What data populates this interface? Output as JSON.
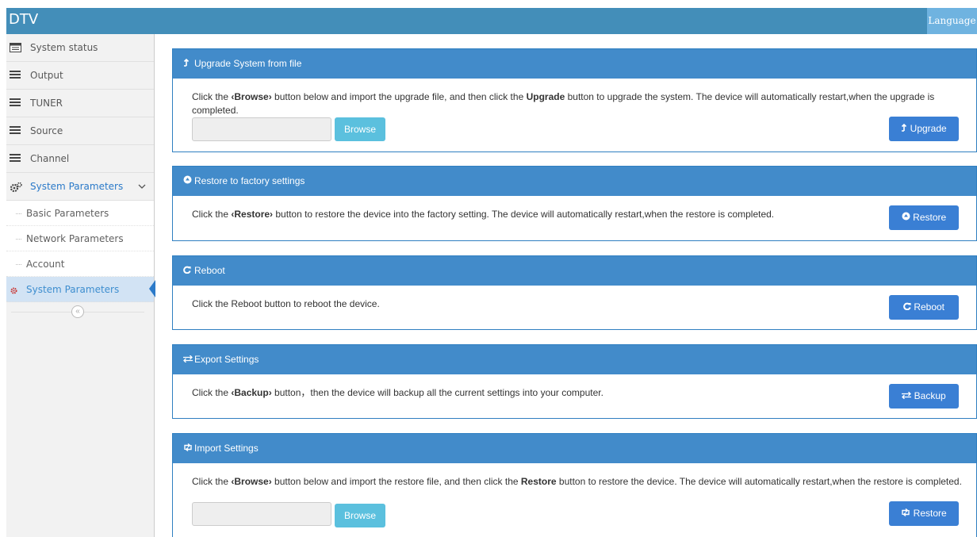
{
  "header": {
    "brand": "DTV",
    "language": "Language"
  },
  "sidebar": {
    "items": [
      {
        "label": "System status"
      },
      {
        "label": "Output"
      },
      {
        "label": "TUNER"
      },
      {
        "label": "Source"
      },
      {
        "label": "Channel"
      },
      {
        "label": "System Parameters"
      }
    ],
    "subitems": [
      {
        "label": "Basic Parameters"
      },
      {
        "label": "Network Parameters"
      },
      {
        "label": "Account"
      },
      {
        "label": "System Parameters"
      }
    ],
    "collapse_glyph": "«"
  },
  "panels": {
    "upgrade": {
      "title": "Upgrade System from file",
      "text_1": "Click the ",
      "text_2": "‹Browse›",
      "text_3": " button below and import the upgrade file, and then click the ",
      "text_4": "Upgrade",
      "text_5": " button to upgrade the system. The device will automatically restart,when the upgrade is completed.",
      "browse_label": "Browse",
      "button_label": "Upgrade"
    },
    "restore": {
      "title": "Restore to factory settings",
      "text_1": "Click the ",
      "text_2": "‹Restore›",
      "text_3": " button to restore the device into the factory setting. The device will automatically restart,when the restore is completed.",
      "button_label": "Restore"
    },
    "reboot": {
      "title": "Reboot",
      "text": "Click the Reboot button to reboot the device.",
      "button_label": "Reboot"
    },
    "export": {
      "title": "Export Settings",
      "text_1": "Click the ",
      "text_2": "‹Backup›",
      "text_3": " button，then the device will backup all the current settings into your computer.",
      "button_label": "Backup"
    },
    "import": {
      "title": "Import Settings",
      "text_1": "Click the ",
      "text_2": "‹Browse›",
      "text_3": " button below and import the restore file, and then click the ",
      "text_4": "Restore",
      "text_5": " button to restore the device. The device will automatically restart,when the restore is completed.",
      "browse_label": "Browse",
      "button_label": "Restore"
    }
  },
  "colors": {
    "header_bg": "#438eb9",
    "panel_head": "#428bca",
    "primary_button": "#3a7fd4",
    "browse_button": "#5bc0de",
    "active_item_bg": "#d2e3f4"
  }
}
